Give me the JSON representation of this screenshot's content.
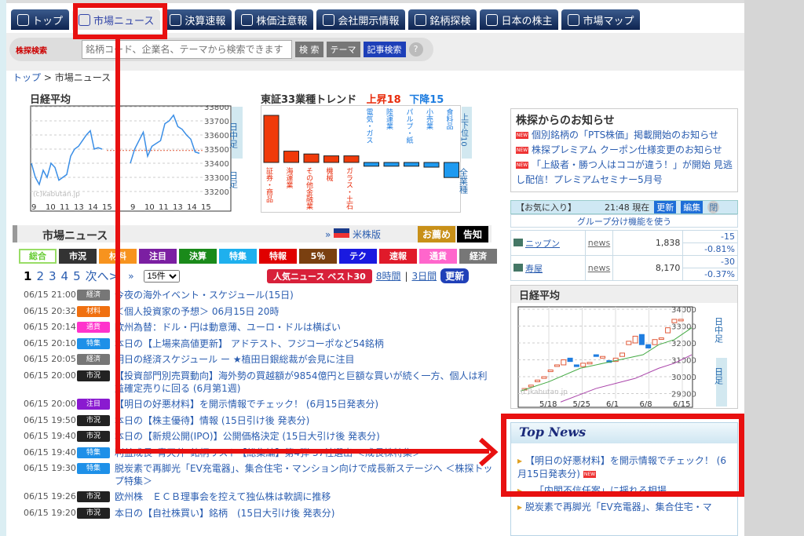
{
  "nav": {
    "tabs": [
      {
        "label": "トップ",
        "icon": "home-icon"
      },
      {
        "label": "市場ニュース",
        "icon": "chart-icon",
        "active": true
      },
      {
        "label": "決算速報",
        "icon": "yen-icon"
      },
      {
        "label": "株価注意報",
        "icon": "warning-icon"
      },
      {
        "label": "会社開示情報",
        "icon": "building-icon"
      },
      {
        "label": "銘柄探検",
        "icon": "search-icon"
      },
      {
        "label": "日本の株主",
        "icon": "person-icon"
      },
      {
        "label": "市場マップ",
        "icon": "map-icon"
      }
    ]
  },
  "search": {
    "logo": "株探検索",
    "placeholder": "銘柄コード、企業名、テーマから検索できます",
    "search_label": "検 索",
    "theme_label": "テーマ",
    "article_label": "記事検索",
    "help": "?"
  },
  "breadcrumb": {
    "home": "トップ",
    "sep": ">",
    "current": "市場ニュース"
  },
  "nikkei_intraday": {
    "title": "日経平均",
    "watermark": "(c)kabutan.jp",
    "yticks": [
      "33800",
      "33700",
      "33600",
      "33500",
      "33400",
      "33300",
      "33200"
    ],
    "xticks": [
      "9",
      "10",
      "11",
      "13",
      "14",
      "15",
      "9",
      "10",
      "11",
      "13",
      "14",
      "15"
    ],
    "side_top": "日中足",
    "side_bottom": "日足",
    "color": "#3a8ee6",
    "ref_color": "#e05a3a"
  },
  "sector": {
    "title": "東証33業種トレンド",
    "up": "上昇18",
    "down": "下降15",
    "up_color": "#e82c0c",
    "down_color": "#1e7de0",
    "side_top": "上下位10",
    "side_bottom": "全業種",
    "bars": [
      {
        "name": "証券・商品",
        "value": 5
      },
      {
        "name": "海運業",
        "value": 1.2
      },
      {
        "name": "その他金融業",
        "value": 0.9
      },
      {
        "name": "機械",
        "value": 0.7
      },
      {
        "name": "ガラス・土石",
        "value": 0.7
      },
      {
        "name": "電気・ガス",
        "value": -0.4
      },
      {
        "name": "陸運業",
        "value": -0.4
      },
      {
        "name": "パルプ・紙",
        "value": -0.4
      },
      {
        "name": "小売業",
        "value": -0.5
      },
      {
        "name": "食料品",
        "value": -1.6
      }
    ]
  },
  "market_news": {
    "title": "市場ニュース",
    "us_link": "米株版",
    "recommend": "お薦め",
    "notice": "告知",
    "categories": [
      {
        "label": "総合",
        "color": "#ffffff"
      },
      {
        "label": "市況",
        "color": "#333333"
      },
      {
        "label": "材料",
        "color": "#f7931e"
      },
      {
        "label": "注目",
        "color": "#7b1fa2"
      },
      {
        "label": "決算",
        "color": "#1a8a1a"
      },
      {
        "label": "特集",
        "color": "#1eb0ee"
      },
      {
        "label": "特報",
        "color": "#e00000"
      },
      {
        "label": "5％",
        "color": "#7a4010"
      },
      {
        "label": "テク",
        "color": "#1a1ae0"
      },
      {
        "label": "速報",
        "color": "#e01a2a"
      },
      {
        "label": "通貨",
        "color": "#ff66cc"
      },
      {
        "label": "経済",
        "color": "#777777"
      }
    ],
    "pages": [
      "1",
      "2",
      "3",
      "4",
      "5"
    ],
    "next": "次へ>",
    "last": "»",
    "per_page": "15件",
    "popular": "人気ニュース ベスト30",
    "h8": "8時間",
    "d3": "3日間",
    "refresh": "更新",
    "items": [
      {
        "time": "06/15 21:00",
        "cat": "経済",
        "color": "#777777",
        "title": "今夜の海外イベント・スケジュール(15日)"
      },
      {
        "time": "06/15 20:32",
        "cat": "材料",
        "color": "#f07010",
        "title": "＜個人投資家の予想＞ 06月15日 20時"
      },
      {
        "time": "06/15 20:14",
        "cat": "通貨",
        "color": "#ff33cc",
        "title": "欧州為替：ドル・円は動意薄、ユーロ・ドルは横ばい"
      },
      {
        "time": "06/15 20:10",
        "cat": "特集",
        "color": "#1e90e8",
        "title": "本日の【上場来高値更新】 アドテスト、フジコーポなど54銘柄"
      },
      {
        "time": "06/15 20:05",
        "cat": "経済",
        "color": "#777777",
        "title": "明日の経済スケジュール ー ★植田日銀総裁が会見に注目"
      },
      {
        "time": "06/15 20:00",
        "cat": "市況",
        "color": "#222222",
        "title": "【投資部門別売買動向】海外勢の買越額が9854億円と巨額な買いが続く一方、個人は利益確定売りに回る (6月第1週)",
        "tall": true
      },
      {
        "time": "06/15 20:00",
        "cat": "注目",
        "color": "#8a1ad0",
        "title": "【明日の好悪材料】を開示情報でチェック！ (6月15日発表分)"
      },
      {
        "time": "06/15 19:50",
        "cat": "市況",
        "color": "#222222",
        "title": "本日の【株主優待】情報 (15日引け後 発表分)"
      },
      {
        "time": "06/15 19:40",
        "cat": "市況",
        "color": "#222222",
        "title": "本日の【新規公開(IPO)】公開価格決定 (15日大引け後 発表分)"
      },
      {
        "time": "06/15 19:40",
        "cat": "特集",
        "color": "#1e90e8",
        "title": "利益成長“青天井”銘柄リスト【総集編】第4弾 37社選出 ＜成長株特集＞"
      },
      {
        "time": "06/15 19:30",
        "cat": "特集",
        "color": "#1e90e8",
        "title": "脱炭素で再脚光「EV充電器」、集合住宅・マンション向けで成長新ステージへ ＜株探トップ特集＞",
        "tall": true
      },
      {
        "time": "06/15 19:26",
        "cat": "市況",
        "color": "#222222",
        "title": "欧州株　ＥＣＢ理事会を控えて独仏株は軟調に推移"
      },
      {
        "time": "06/15 19:20",
        "cat": "市況",
        "color": "#222222",
        "title": "本日の【自社株買い】銘柄　(15日大引け後 発表分)"
      }
    ]
  },
  "notices": {
    "title": "株探からのお知らせ",
    "items": [
      "個別銘柄の「PTS株価」掲載開始のお知らせ",
      "株探プレミアム クーポン仕様変更のお知らせ",
      "「上級者・勝つ人はココが違う！」が開始 見逃し配信！プレミアムセミナー5月号"
    ]
  },
  "favorites": {
    "title": "【お気に入り】",
    "time": "21:48 現在",
    "refresh": "更新",
    "edit": "編集",
    "close": "閉",
    "group": "グループ分け機能を使う",
    "rows": [
      {
        "name": "ニップン",
        "news": "news",
        "price": "1,838",
        "chg": "-15",
        "pct": "-0.81%"
      },
      {
        "name": "寿屋",
        "news": "news",
        "price": "8,170",
        "chg": "-30",
        "pct": "-0.37%"
      }
    ]
  },
  "nikkei_daily": {
    "title": "日経平均",
    "watermark": "(c)kabutan.jp",
    "yticks": [
      "34000",
      "33000",
      "32000",
      "31000",
      "30000",
      "29000"
    ],
    "xticks": [
      "5/18",
      "5/25",
      "6/1",
      "6/8",
      "6/15"
    ],
    "side_top": "日中足",
    "side_bottom": "日足"
  },
  "top_news": {
    "title": "Top News",
    "items": [
      "【明日の好悪材料】を開示情報でチェック！ (6月15日発表分)",
      "…「内閣不信任案」に揺れる相場",
      "脱炭素で再脚光「EV充電器」、集合住宅・マ"
    ]
  },
  "annotation_color": "#e81010"
}
